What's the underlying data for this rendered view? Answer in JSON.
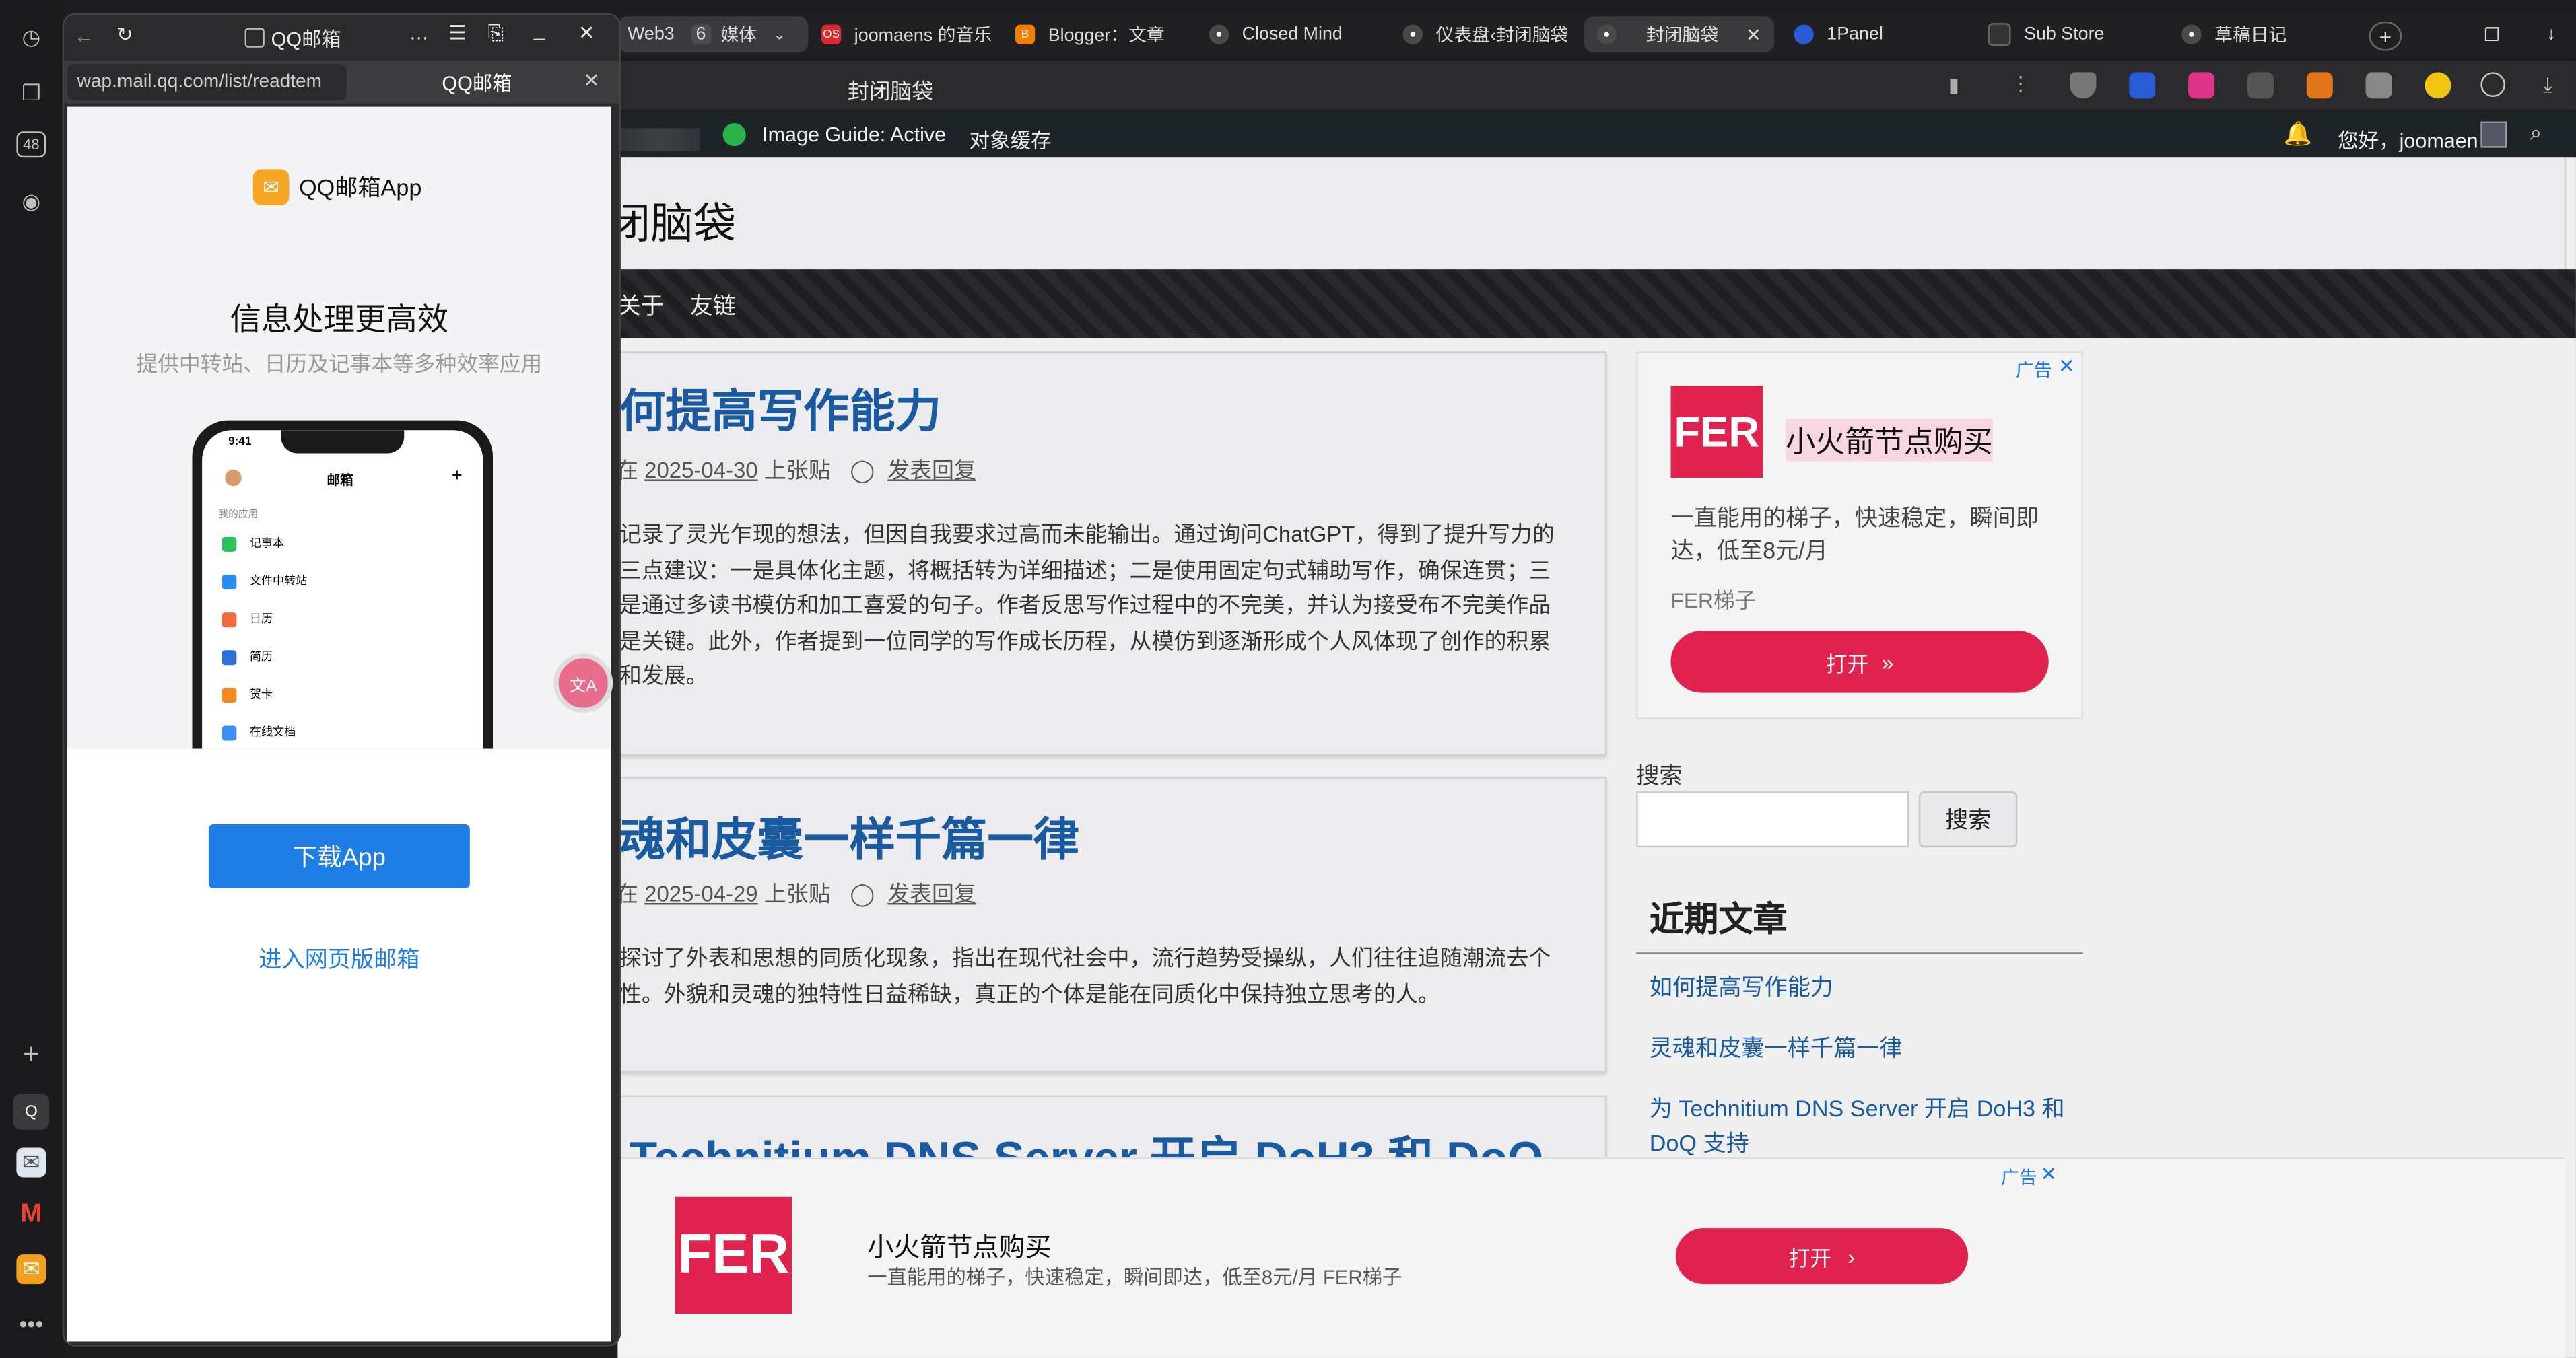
{
  "sidebar": {
    "tab_count": "48",
    "app_q": "Q"
  },
  "tabs": {
    "group_name": "Web3",
    "group_count": "6",
    "group_media": "媒体",
    "items": [
      {
        "label": "joomaens 的音乐",
        "icon": "music-icon",
        "color": "#d92b2b",
        "fav": "OS"
      },
      {
        "label": "Blogger：文章",
        "icon": "blogger-icon",
        "color": "#f57c00",
        "fav": "B"
      },
      {
        "label": "Closed Mind",
        "icon": "brain-icon",
        "color": "#777777",
        "fav": ""
      },
      {
        "label": "仪表盘‹封闭脑袋",
        "icon": "brain-icon",
        "color": "#777777",
        "fav": ""
      },
      {
        "label": "封闭脑袋",
        "icon": "brain-icon",
        "color": "#777777",
        "fav": ""
      },
      {
        "label": "1Panel",
        "icon": "panel-icon",
        "color": "#2a5bd7",
        "fav": ""
      },
      {
        "label": "Sub Store",
        "icon": "store-icon",
        "color": "#333333",
        "fav": ""
      },
      {
        "label": "草稿日记",
        "icon": "brain-icon",
        "color": "#777777",
        "fav": ""
      }
    ]
  },
  "address": {
    "title": "封闭脑袋"
  },
  "adminbar": {
    "image_guide": "Image Guide: Active",
    "cache": "对象缓存",
    "greeting": "您好，joomaen"
  },
  "site": {
    "title": "闭脑袋",
    "nav": [
      "关于",
      "友链"
    ]
  },
  "posts": [
    {
      "title": "何提高写作能力",
      "prefix": "在",
      "date": "2025-04-30",
      "author": "上张贴",
      "reply": "发表回复",
      "excerpt": "记录了灵光乍现的想法，但因自我要求过高而未能输出。通过询问ChatGPT，得到了提升写力的三点建议：一是具体化主题，将概括转为详细描述；二是使用固定句式辅助写作，确保连贯；三是通过多读书模仿和加工喜爱的句子。作者反思写作过程中的不完美，并认为接受布不完美作品是关键。此外，作者提到一位同学的写作成长历程，从模仿到逐渐形成个人风体现了创作的积累和发展。"
    },
    {
      "title": "魂和皮囊一样千篇一律",
      "prefix": "在",
      "date": "2025-04-29",
      "author": "上张贴",
      "reply": "发表回复",
      "excerpt": "探讨了外表和思想的同质化现象，指出在现代社会中，流行趋势受操纵，人们往往追随潮流去个性。外貌和灵魂的独特性日益稀缺，真正的个体是能在同质化中保持独立思考的人。"
    },
    {
      "title": "Technitium DNS Server 开启 DoH3 和 DoQ"
    }
  ],
  "sidebar_ad": {
    "tag": "广告",
    "logo": "FER",
    "headline": "小火箭节点购买",
    "body": "一直能用的梯子，快速稳定，瞬间即达，低至8元/月",
    "brand": "FER梯子",
    "button": "打开"
  },
  "search": {
    "label": "搜索",
    "button": "搜索",
    "placeholder": ""
  },
  "recent": {
    "heading": "近期文章",
    "items": [
      "如何提高写作能力",
      "灵魂和皮囊一样千篇一律",
      "为 Technitium DNS Server 开启 DoH3 和 DoQ 支持"
    ]
  },
  "bottom_ad": {
    "tag": "广告",
    "logo": "FER",
    "headline": "小火箭节点购买",
    "body": "一直能用的梯子，快速稳定，瞬间即达，低至8元/月 FER梯子",
    "button": "打开"
  },
  "popup": {
    "title": "QQ邮箱",
    "url": "wap.mail.qq.com/list/readtem",
    "tab_title": "QQ邮箱",
    "app_name": "QQ邮箱App",
    "heading": "信息处理更高效",
    "subheading": "提供中转站、日历及记事本等多种效率应用",
    "phone": {
      "time": "9:41",
      "title": "邮箱",
      "section": "我的应用",
      "apps": [
        {
          "label": "记事本",
          "color": "#2fbf5b"
        },
        {
          "label": "文件中转站",
          "color": "#2d8cf0"
        },
        {
          "label": "日历",
          "color": "#f26b3a"
        },
        {
          "label": "简历",
          "color": "#2d6fd6"
        },
        {
          "label": "贺卡",
          "color": "#f58a1f"
        },
        {
          "label": "在线文档",
          "color": "#3a8ef5"
        }
      ]
    },
    "download": "下载App",
    "web_link": "进入网页版邮箱"
  },
  "colors": {
    "accent_red": "#e0224e",
    "link_blue": "#1a5aa0",
    "qq_blue": "#1f7de6"
  }
}
